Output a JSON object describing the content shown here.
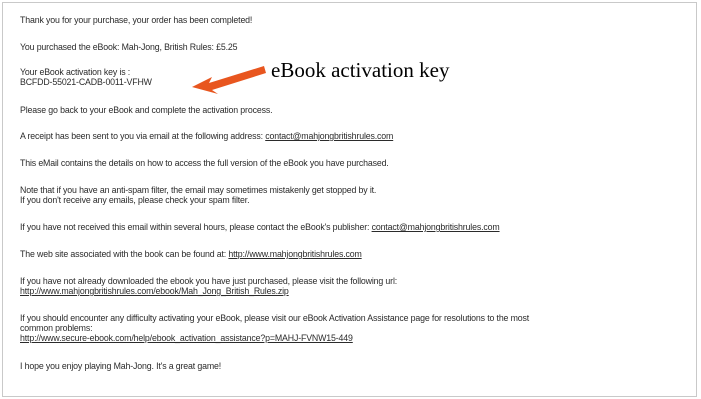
{
  "annotation": {
    "label": "eBook activation key",
    "arrow_color": "#e8561f"
  },
  "email": {
    "thank_you": "Thank you for your purchase, your order has been completed!",
    "purchased": "You purchased the eBook: Mah-Jong, British Rules: £5.25",
    "key_label": "Your eBook activation key is :",
    "key_value": "BCFDD-55021-CADB-0011-VFHW",
    "go_back": "Please go back to your eBook and complete the activation process.",
    "receipt_prefix": "A receipt has been sent to you via email at the following address:",
    "receipt_email": "contact@mahjongbritishrules.com",
    "contains_details": "This eMail contains the details on how to access the full version of the eBook you have purchased.",
    "spam_note_1": "Note that if you have an anti-spam filter, the email may sometimes mistakenly get stopped by it.",
    "spam_note_2": "If you don't receive any emails, please check your spam filter.",
    "not_received_prefix": "If you have not received this email within several hours, please contact the eBook's publisher:",
    "publisher_email": "contact@mahjongbritishrules.com",
    "website_prefix": "The web site associated with the book can be found at:",
    "website_url": "http://www.mahjongbritishrules.com",
    "download_prefix": "If you have not already downloaded the ebook you have just purchased, please visit the following url:",
    "download_url": "http://www.mahjongbritishrules.com/ebook/Mah_Jong_British_Rules.zip",
    "difficulty_1": "If you should encounter any difficulty activating your eBook, please visit our eBook Activation Assistance page for resolutions to the most",
    "difficulty_2": "common problems:",
    "assistance_url": "http://www.secure-ebook.com/help/ebook_activation_assistance?p=MAHJ-FVNW15-449",
    "closing": "I hope you enjoy playing Mah-Jong. It's a great game!"
  }
}
